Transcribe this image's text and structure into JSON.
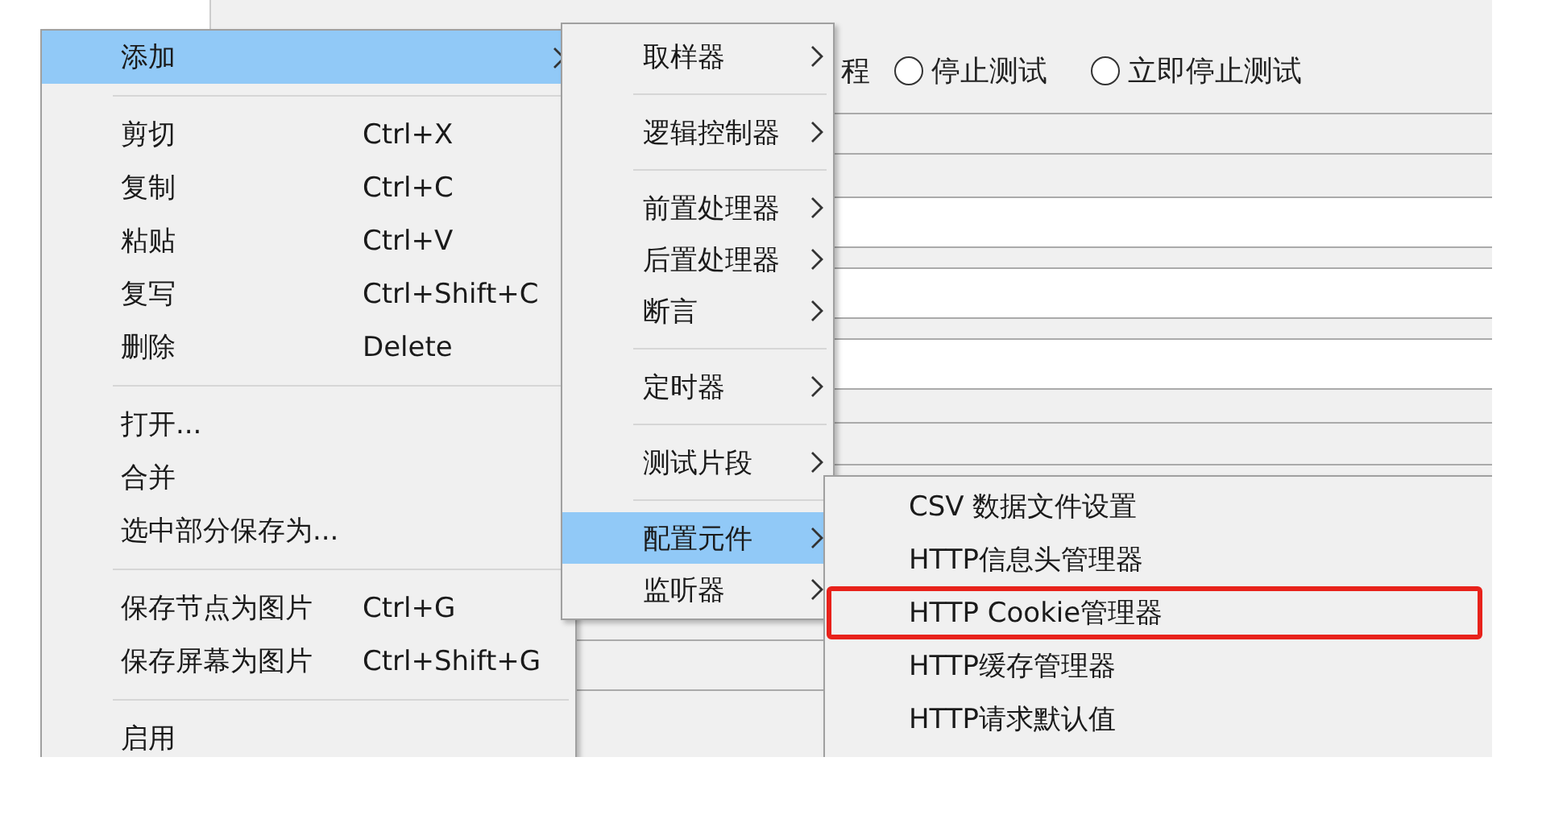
{
  "background": {
    "partial_label": "程",
    "radios": [
      {
        "label": "停止测试",
        "selected": false
      },
      {
        "label": "立即停止测试",
        "selected": false
      }
    ]
  },
  "context_menu": {
    "groups": [
      [
        {
          "label": "添加",
          "submenu": true,
          "selected": true
        }
      ],
      [
        {
          "label": "剪切",
          "shortcut": "Ctrl+X",
          "submenu": false,
          "selected": false
        },
        {
          "label": "复制",
          "shortcut": "Ctrl+C",
          "submenu": false,
          "selected": false
        },
        {
          "label": "粘贴",
          "shortcut": "Ctrl+V",
          "submenu": false,
          "selected": false
        },
        {
          "label": "复写",
          "shortcut": "Ctrl+Shift+C",
          "submenu": false,
          "selected": false
        },
        {
          "label": "删除",
          "shortcut": "Delete",
          "submenu": false,
          "selected": false
        }
      ],
      [
        {
          "label": "打开...",
          "submenu": false,
          "selected": false
        },
        {
          "label": "合并",
          "submenu": false,
          "selected": false
        },
        {
          "label": "选中部分保存为...",
          "submenu": false,
          "selected": false
        }
      ],
      [
        {
          "label": "保存节点为图片",
          "shortcut": "Ctrl+G",
          "submenu": false,
          "selected": false
        },
        {
          "label": "保存屏幕为图片",
          "shortcut": "Ctrl+Shift+G",
          "submenu": false,
          "selected": false
        }
      ],
      [
        {
          "label": "启用",
          "submenu": false,
          "selected": false
        }
      ]
    ]
  },
  "add_submenu": {
    "groups": [
      [
        {
          "label": "取样器",
          "selected": false
        }
      ],
      [
        {
          "label": "逻辑控制器",
          "selected": false
        }
      ],
      [
        {
          "label": "前置处理器",
          "selected": false
        },
        {
          "label": "后置处理器",
          "selected": false
        },
        {
          "label": "断言",
          "selected": false
        }
      ],
      [
        {
          "label": "定时器",
          "selected": false
        }
      ],
      [
        {
          "label": "测试片段",
          "selected": false
        }
      ],
      [
        {
          "label": "配置元件",
          "selected": true
        },
        {
          "label": "监听器",
          "selected": false
        }
      ]
    ]
  },
  "config_submenu": {
    "items": [
      {
        "label": "CSV 数据文件设置",
        "highlighted": false
      },
      {
        "label": "HTTP信息头管理器",
        "highlighted": false
      },
      {
        "label": "HTTP Cookie管理器",
        "highlighted": true
      },
      {
        "label": "HTTP缓存管理器",
        "highlighted": false
      },
      {
        "label": "HTTP请求默认值",
        "highlighted": false
      }
    ]
  }
}
